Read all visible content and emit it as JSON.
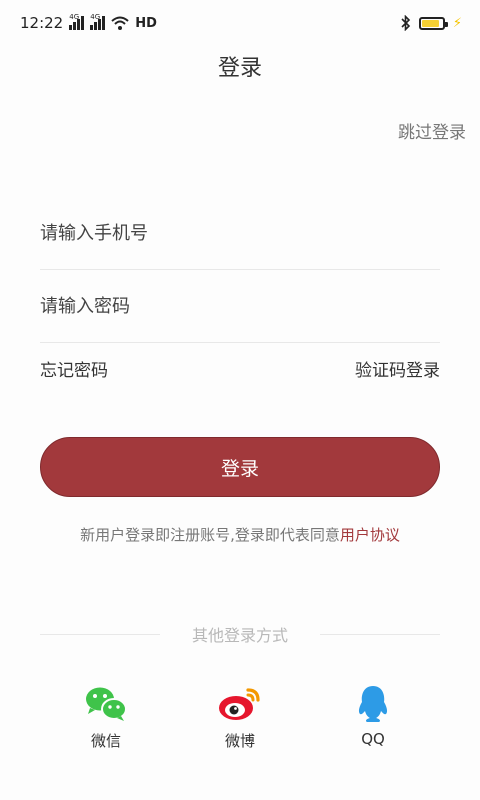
{
  "status_bar": {
    "time": "12:22",
    "network_1": "4G",
    "network_2": "4G",
    "hd": "HD"
  },
  "header": {
    "title": "登录",
    "skip_label": "跳过登录"
  },
  "form": {
    "phone_placeholder": "请输入手机号",
    "password_placeholder": "请输入密码",
    "forgot_password": "忘记密码",
    "sms_login": "验证码登录",
    "login_button": "登录"
  },
  "terms": {
    "text": "新用户登录即注册账号,登录即代表同意",
    "agreement_link": "用户协议"
  },
  "other_login": {
    "divider_label": "其他登录方式",
    "wechat_label": "微信",
    "weibo_label": "微博",
    "qq_label": "QQ"
  },
  "colors": {
    "accent": "#a2393c",
    "wechat": "#3fc34a",
    "weibo": "#e6162d",
    "qq": "#2d9be6"
  }
}
